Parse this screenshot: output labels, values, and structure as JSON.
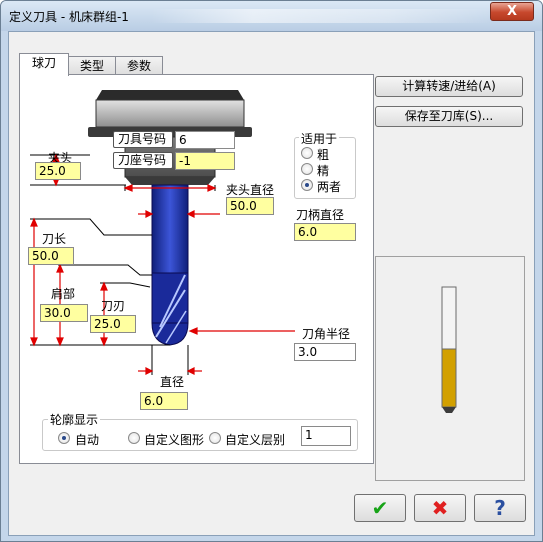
{
  "window": {
    "title": "定义刀具 - 机床群组-1",
    "close_glyph": "X"
  },
  "tabs": [
    {
      "label": "球刀"
    },
    {
      "label": "类型"
    },
    {
      "label": "参数"
    }
  ],
  "tool": {
    "number_label": "刀具号码",
    "number_value": "6",
    "holder_label": "刀座号码",
    "holder_value": "-1",
    "chuck_label": "夹头",
    "chuck_value": "25.0",
    "holder_dia_label": "夹头直径",
    "holder_dia_value": "50.0",
    "shank_dia_label": "刀柄直径",
    "shank_dia_value": "6.0",
    "length_label": "刀长",
    "length_value": "50.0",
    "shoulder_label": "肩部",
    "shoulder_value": "30.0",
    "flute_label": "刀刃",
    "flute_value": "25.0",
    "corner_label": "刀角半径",
    "corner_value": "3.0",
    "diameter_label": "直径",
    "diameter_value": "6.0"
  },
  "apply_to": {
    "title": "适用于",
    "options": [
      {
        "label": "粗"
      },
      {
        "label": "精"
      },
      {
        "label": "两者"
      }
    ],
    "selected": "两者"
  },
  "contour": {
    "title": "轮廓显示",
    "options": [
      {
        "label": "自动"
      },
      {
        "label": "自定义图形"
      },
      {
        "label": "自定义层别"
      }
    ],
    "selected": "自动",
    "level_value": "1"
  },
  "buttons": {
    "calc": "计算转速/进给(A)",
    "save": "保存至刀库(S)...",
    "ok_glyph": "✔",
    "cancel_glyph": "✖",
    "help_glyph": "?"
  },
  "colors": {
    "field": "#ffffa0",
    "tool_blue": "#1a2a9a",
    "arrow_red": "#e00000",
    "insert_gold": "#d2a000"
  }
}
